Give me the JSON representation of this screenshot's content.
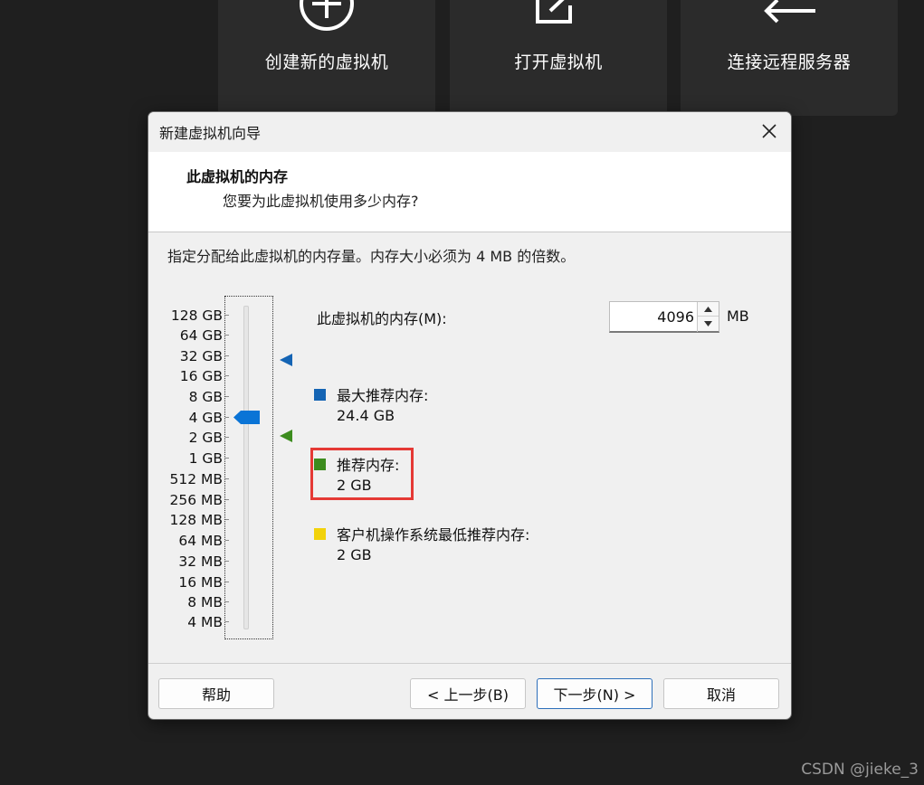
{
  "background_tiles": [
    {
      "label": "创建新的虚拟机",
      "icon": "plus-circle-icon"
    },
    {
      "label": "打开虚拟机",
      "icon": "open-external-icon"
    },
    {
      "label": "连接远程服务器",
      "icon": "arrows-left-right-icon"
    }
  ],
  "watermark": "CSDN @jieke_3",
  "dialog": {
    "title": "新建虚拟机向导",
    "header_title": "此虚拟机的内存",
    "header_subtitle": "您要为此虚拟机使用多少内存?",
    "instruction": "指定分配给此虚拟机的内存量。内存大小必须为 4 MB 的倍数。",
    "scale_labels": [
      "128 GB",
      "64 GB",
      "32 GB",
      "16 GB",
      "8 GB",
      "4 GB",
      "2 GB",
      "1 GB",
      "512 MB",
      "256 MB",
      "128 MB",
      "64 MB",
      "32 MB",
      "16 MB",
      "8 MB",
      "4 MB"
    ],
    "slider_value": "4 GB",
    "memory_label": "此虚拟机的内存(M):",
    "memory_value": "4096",
    "memory_unit": "MB",
    "legend": [
      {
        "title": "最大推荐内存:",
        "value": "24.4 GB",
        "color": "#1464b4"
      },
      {
        "title": "推荐内存:",
        "value": "2 GB",
        "color": "#3c8c1e"
      },
      {
        "title": "客户机操作系统最低推荐内存:",
        "value": "2 GB",
        "color": "#f2d20a"
      }
    ],
    "buttons": {
      "help": "帮助",
      "back": "< 上一步(B)",
      "next": "下一步(N) >",
      "cancel": "取消"
    }
  },
  "colors": {
    "background": "#1f1f1f",
    "highlight": "#e53935",
    "thumb": "#0a74d6"
  }
}
